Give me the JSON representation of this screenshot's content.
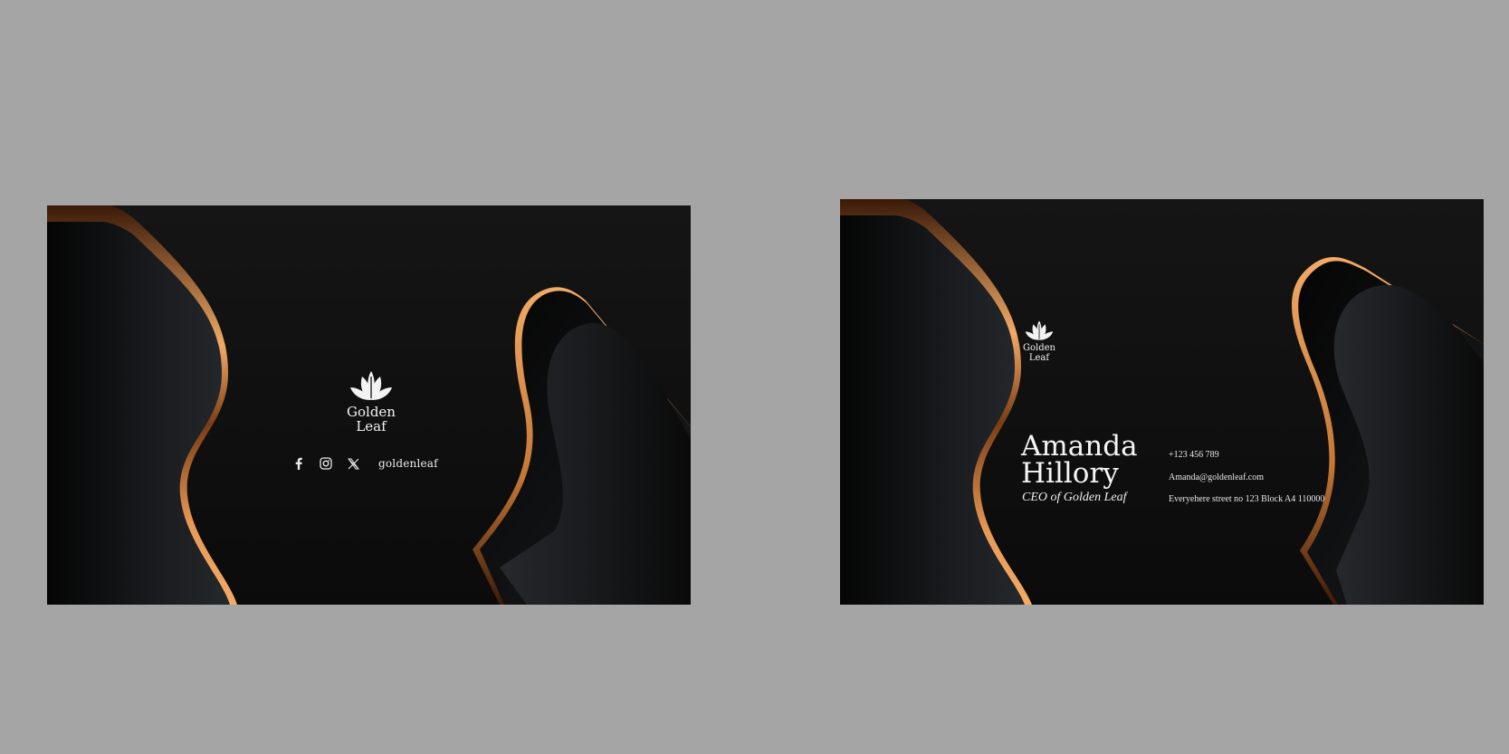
{
  "brand": {
    "name": "Golden Leaf",
    "wordmark_line1": "Golden",
    "wordmark_line2": "Leaf",
    "logo_icon": "lotus-leaf-icon",
    "colors": {
      "background": "#a5a5a5",
      "card": "#121212",
      "gold_light": "#f1a965",
      "gold_dark": "#6b3210",
      "text": "#f3f3f3"
    }
  },
  "front_card": {
    "social_icons": [
      "facebook-icon",
      "instagram-icon",
      "x-icon"
    ],
    "handle": "goldenleaf"
  },
  "back_card": {
    "name_line1": "Amanda",
    "name_line2": "Hillory",
    "title": "CEO of Golden Leaf",
    "phone": "+123 456 789",
    "email": "Amanda@goldenleaf.com",
    "address": "Everyehere street no 123 Block A4 110000"
  }
}
